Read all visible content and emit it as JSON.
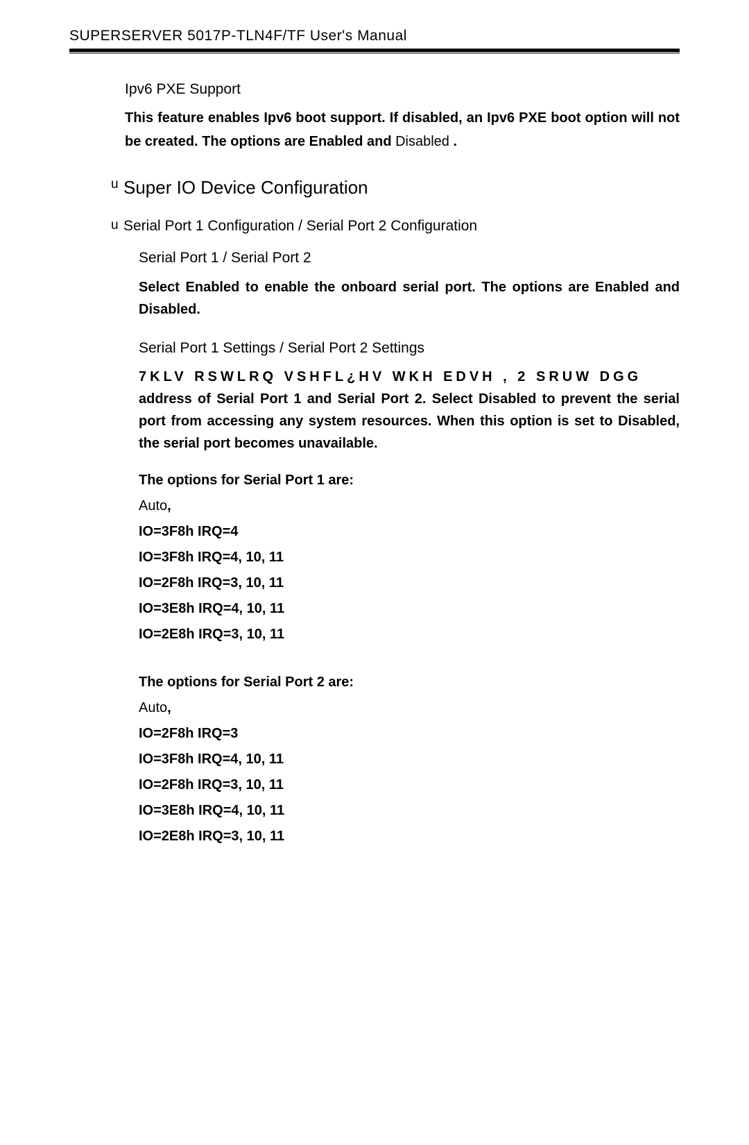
{
  "header": {
    "title": "SUPERSERVER 5017P-TLN4F/TF User's Manual"
  },
  "ipv6": {
    "heading": "Ipv6 PXE Support",
    "body1": "This feature enables Ipv6 boot support.  If disabled, an Ipv6 PXE boot option will not be created. The options are Enabled and ",
    "body1_trailing": "Disabled ",
    "body1_end": "."
  },
  "superio": {
    "bullet": "u",
    "heading": "Super IO Device Configuration"
  },
  "serialcfg": {
    "bullet": "u",
    "heading": "Serial Port 1 Configuration / Serial Port 2 Configuration"
  },
  "serialport": {
    "heading": "Serial Port 1 / Serial Port 2",
    "body": "Select Enabled to enable the onboard serial port. The options are Enabled and Disabled."
  },
  "serialsettings": {
    "heading": "Serial Port 1 Settings / Serial Port 2 Settings",
    "garbled": "7KLV RSWLRQ VSHFL¿HV WKH EDVH , 2 SRUW DGG",
    "body2": "address of Serial Port 1 and Serial Port 2. Select Disabled to prevent the serial port from accessing any system resources. When this option is set to Disabled, the serial port becomes unavailable."
  },
  "port1opts": {
    "heading": "The options for Serial Port 1 are:",
    "auto": "Auto",
    "o1": "IO=3F8h IRQ=4",
    "o2": "IO=3F8h IRQ=4, 10, 11",
    "o3": "IO=2F8h IRQ=3, 10, 11",
    "o4": "IO=3E8h IRQ=4, 10, 11",
    "o5": "IO=2E8h IRQ=3, 10, 11"
  },
  "port2opts": {
    "heading": "The options for Serial Port 2 are:",
    "auto": "Auto",
    "o1": "IO=2F8h IRQ=3",
    "o2": "IO=3F8h IRQ=4, 10, 11",
    "o3": "IO=2F8h IRQ=3, 10, 11",
    "o4": "IO=3E8h IRQ=4, 10, 11",
    "o5": "IO=2E8h IRQ=3, 10, 11"
  },
  "comma": ","
}
